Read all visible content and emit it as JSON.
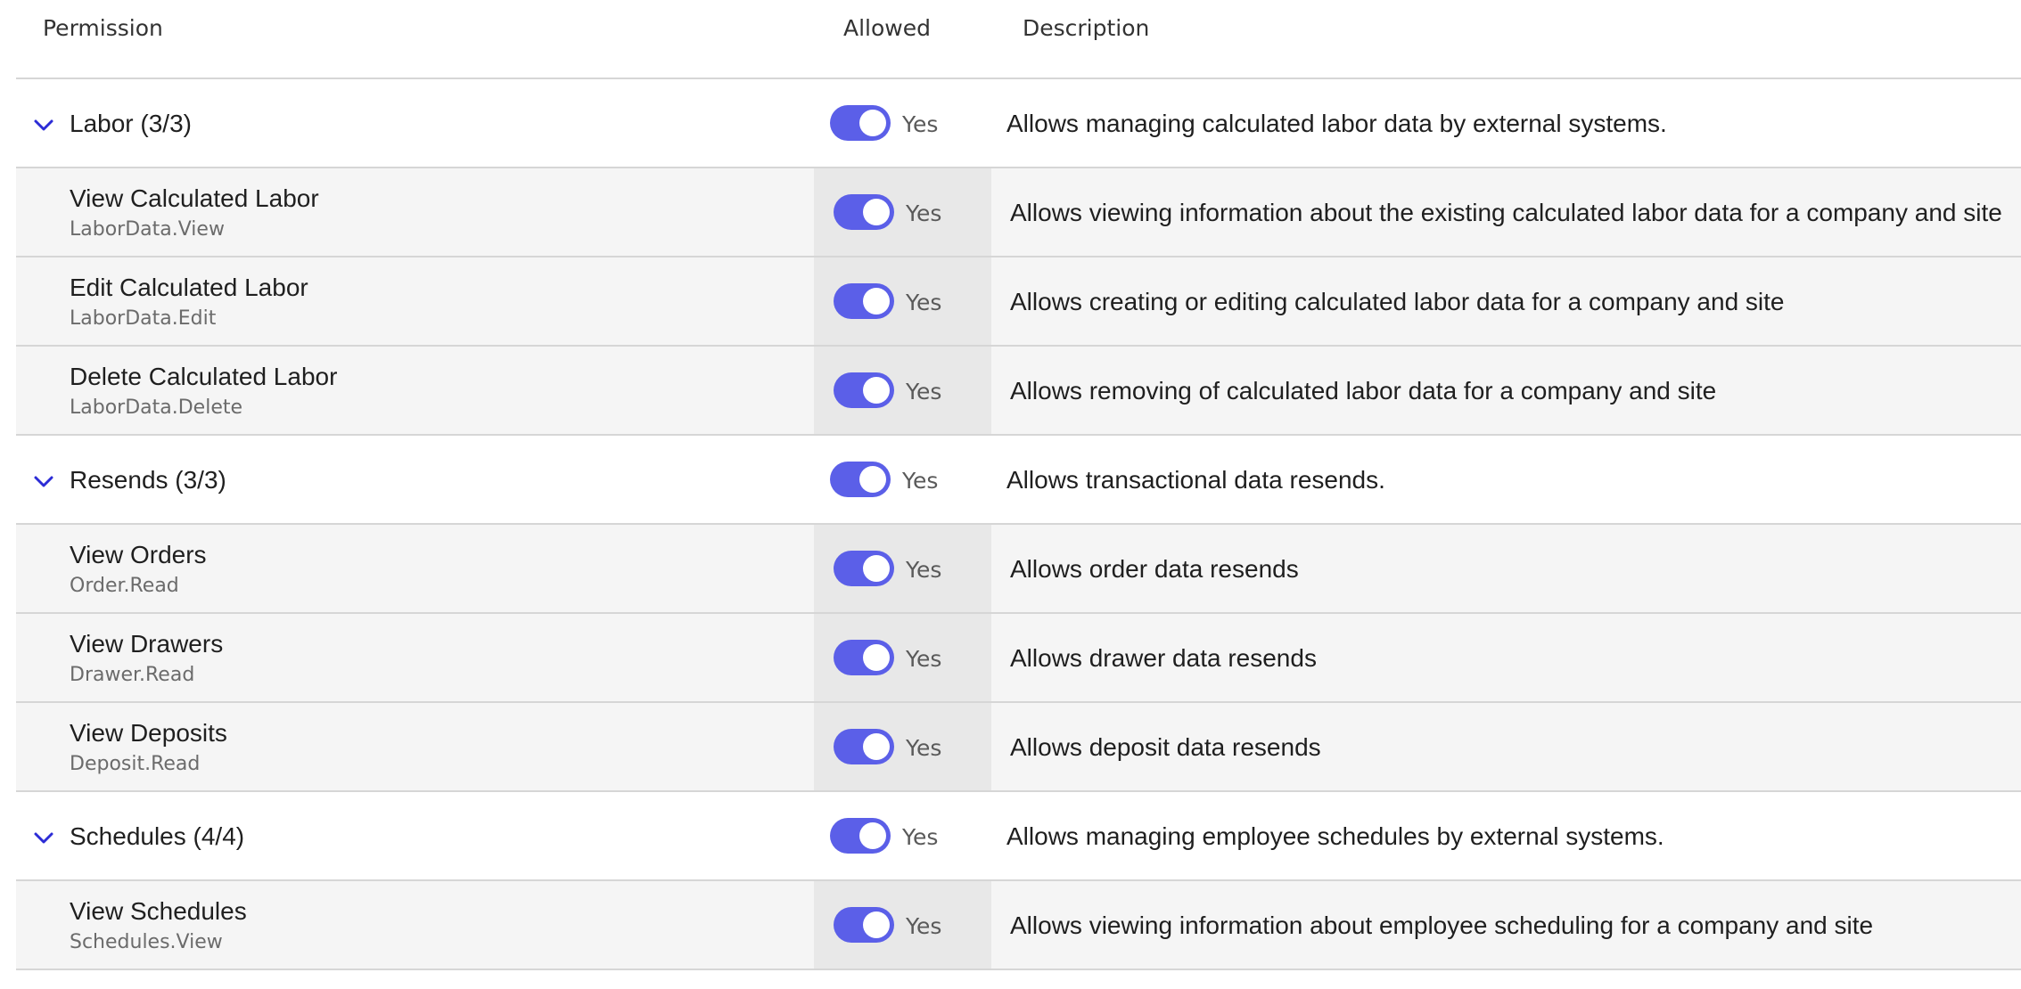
{
  "header": {
    "permission": "Permission",
    "allowed": "Allowed",
    "description": "Description"
  },
  "icons": {
    "chevron": "chevron-down-icon"
  },
  "colors": {
    "toggle_on": "#5b5fe8",
    "chevron": "#2c2cd6"
  },
  "groups": [
    {
      "title": "Labor (3/3)",
      "allowed": "Yes",
      "description": "Allows managing calculated labor data by external systems.",
      "items": [
        {
          "title": "View Calculated Labor",
          "code": "LaborData.View",
          "allowed": "Yes",
          "description": "Allows viewing information about the existing calculated labor data for a company and site"
        },
        {
          "title": "Edit Calculated Labor",
          "code": "LaborData.Edit",
          "allowed": "Yes",
          "description": "Allows creating or editing calculated labor data for a company and site"
        },
        {
          "title": "Delete Calculated Labor",
          "code": "LaborData.Delete",
          "allowed": "Yes",
          "description": "Allows removing of calculated labor data for a company and site"
        }
      ]
    },
    {
      "title": "Resends (3/3)",
      "allowed": "Yes",
      "description": "Allows transactional data resends.",
      "items": [
        {
          "title": "View Orders",
          "code": "Order.Read",
          "allowed": "Yes",
          "description": "Allows order data resends"
        },
        {
          "title": "View Drawers",
          "code": "Drawer.Read",
          "allowed": "Yes",
          "description": "Allows drawer data resends"
        },
        {
          "title": "View Deposits",
          "code": "Deposit.Read",
          "allowed": "Yes",
          "description": "Allows deposit data resends"
        }
      ]
    },
    {
      "title": "Schedules (4/4)",
      "allowed": "Yes",
      "description": "Allows managing employee schedules by external systems.",
      "items": [
        {
          "title": "View Schedules",
          "code": "Schedules.View",
          "allowed": "Yes",
          "description": "Allows viewing information about employee scheduling for a company and site"
        }
      ]
    }
  ]
}
